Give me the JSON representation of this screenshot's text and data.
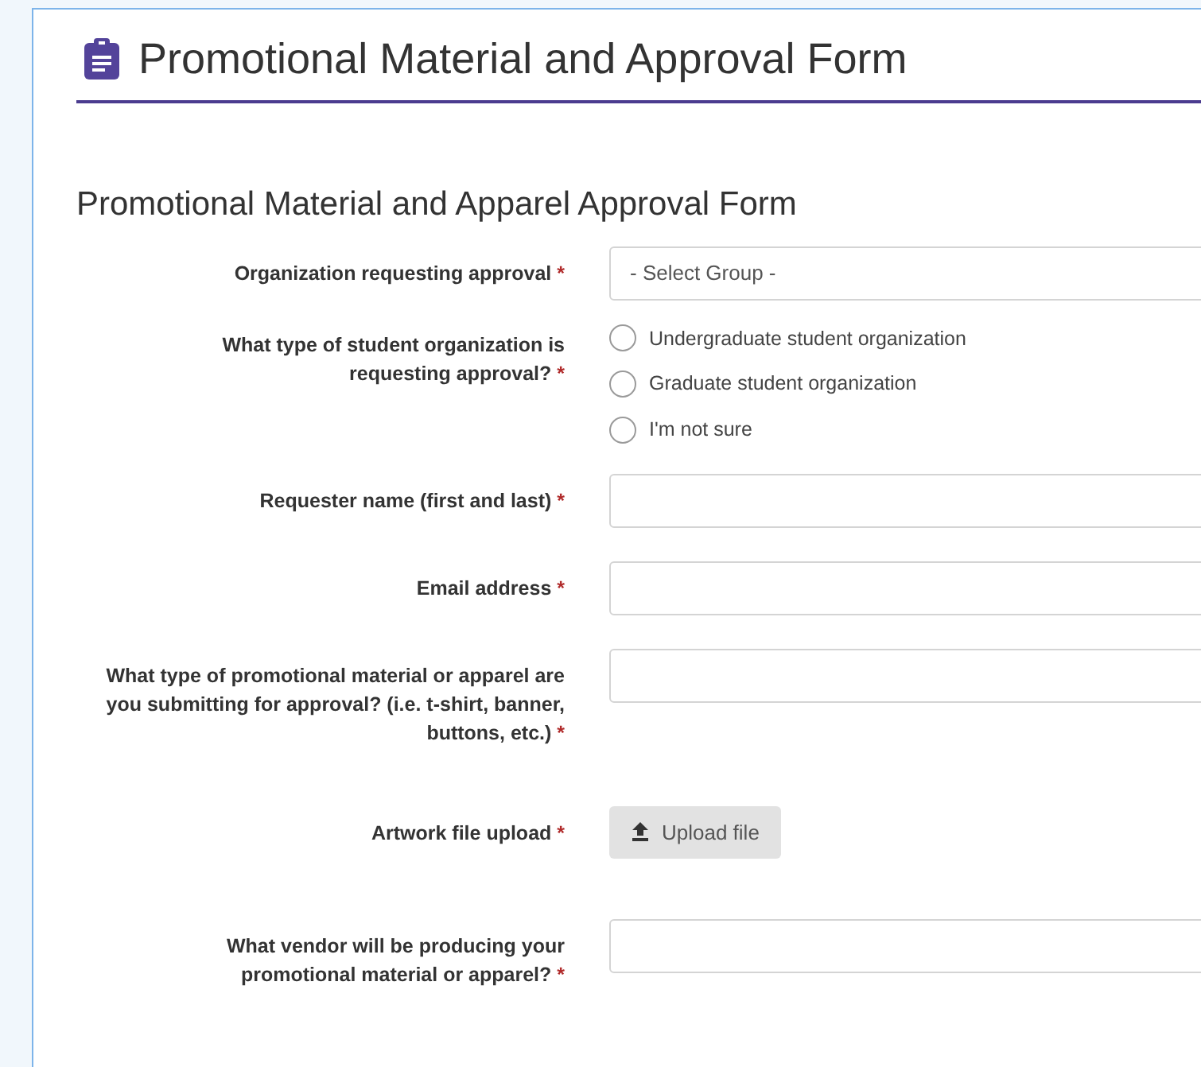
{
  "header": {
    "title": "Promotional Material and Approval Form"
  },
  "form": {
    "title": "Promotional Material and Apparel Approval Form",
    "fields": [
      {
        "kind": "select",
        "label": "Organization requesting approval",
        "required_mark": "*",
        "placeholder": "- Select Group -"
      },
      {
        "kind": "radio",
        "label": "What type of student organization is requesting approval?",
        "required_mark": "*",
        "options": [
          {
            "label": "Undergraduate student organization",
            "selected": false
          },
          {
            "label": "Graduate student organization",
            "selected": false
          },
          {
            "label": "I'm not sure",
            "selected": false
          }
        ]
      },
      {
        "kind": "text",
        "label": "Requester name (first and last)",
        "required_mark": "*"
      },
      {
        "kind": "text",
        "label": "Email address",
        "required_mark": "*"
      },
      {
        "kind": "text",
        "label": "What type of promotional material or apparel are you submitting for approval? (i.e. t-shirt, banner, buttons, etc.)",
        "required_mark": "*"
      },
      {
        "kind": "upload",
        "label": "Artwork file upload",
        "required_mark": "*",
        "button": "Upload file"
      },
      {
        "kind": "text",
        "label": "What vendor will be producing your promotional material or apparel?",
        "required_mark": "*"
      }
    ]
  }
}
